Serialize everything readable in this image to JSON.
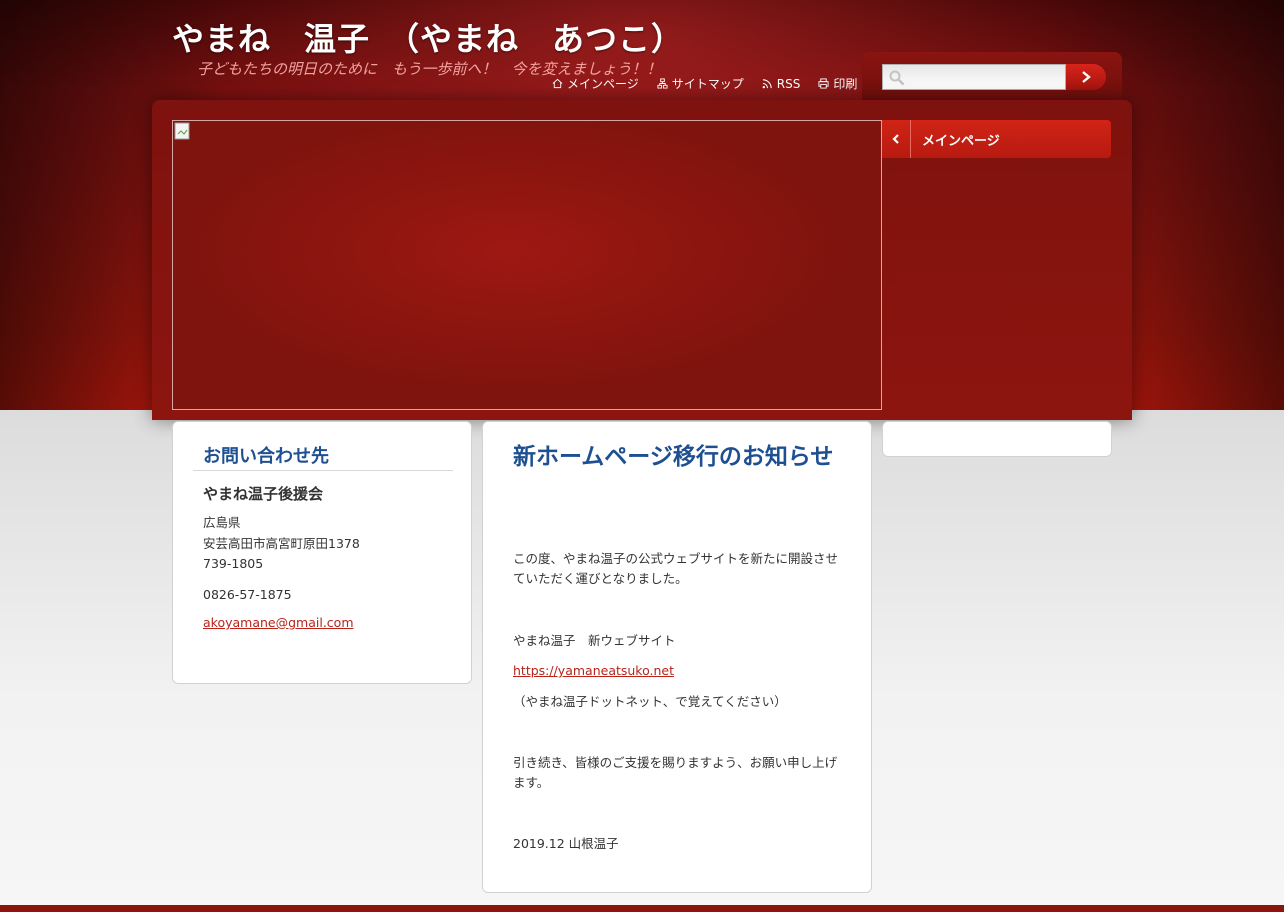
{
  "header": {
    "site_title": "やまね　温子　（やまね　あつこ）",
    "slogan": "子どもたちの明日のために　もう一歩前へ！　今を変えましょう！！",
    "top_links": [
      {
        "label": "メインページ",
        "icon": "home-icon"
      },
      {
        "label": "サイトマップ",
        "icon": "sitemap-icon"
      },
      {
        "label": "RSS",
        "icon": "rss-icon"
      },
      {
        "label": "印刷",
        "icon": "print-icon"
      }
    ]
  },
  "search": {
    "placeholder": "",
    "icon": "search-icon",
    "submit_icon": "chevron-right-icon"
  },
  "menu": {
    "items": [
      {
        "label": "メインページ",
        "icon": "chevron-left-icon"
      }
    ]
  },
  "contact": {
    "title": "お問い合わせ先",
    "name": "やまね温子後援会",
    "prefecture": "広島県",
    "address": "安芸高田市高宮町原田1378",
    "postal": "739-1805",
    "phone": "0826-57-1875",
    "email": "akoyamane@gmail.com"
  },
  "article": {
    "title": "新ホームページ移行のお知らせ",
    "p1": "この度、やまね温子の公式ウェブサイトを新たに開設させていただく運びとなりました。",
    "p2": "やまね温子　新ウェブサイト",
    "link": "https://yamaneatsuko.net",
    "p3": "（やまね温子ドットネット、で覚えてください）",
    "p4": "引き続き、皆様のご支援を賜りますよう、お願い申し上げます。",
    "p5": "2019.12 山根温子"
  },
  "colors": {
    "brand_red": "#b81a10",
    "title_blue": "#1e4f91",
    "link_red": "#b8241a"
  }
}
